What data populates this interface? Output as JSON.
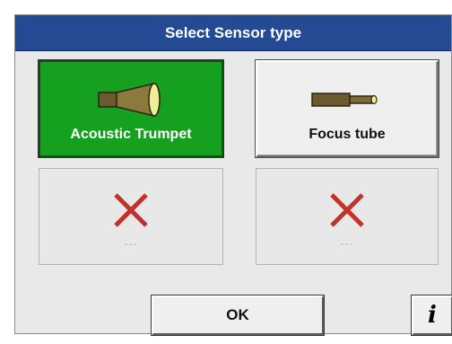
{
  "dialog": {
    "title": "Select Sensor type",
    "options": [
      {
        "label": "Acoustic Trumpet",
        "icon": "acoustic-trumpet-icon",
        "state": "selected"
      },
      {
        "label": "Focus tube",
        "icon": "focus-tube-icon",
        "state": "available"
      },
      {
        "label": "---",
        "icon": "unavailable-x-icon",
        "state": "disabled"
      },
      {
        "label": "---",
        "icon": "unavailable-x-icon",
        "state": "disabled"
      }
    ],
    "ok_label": "OK",
    "info_label": "i"
  },
  "colors": {
    "title_bar": "#234a93",
    "selected": "#15a01f",
    "x_mark": "#c0322a"
  }
}
